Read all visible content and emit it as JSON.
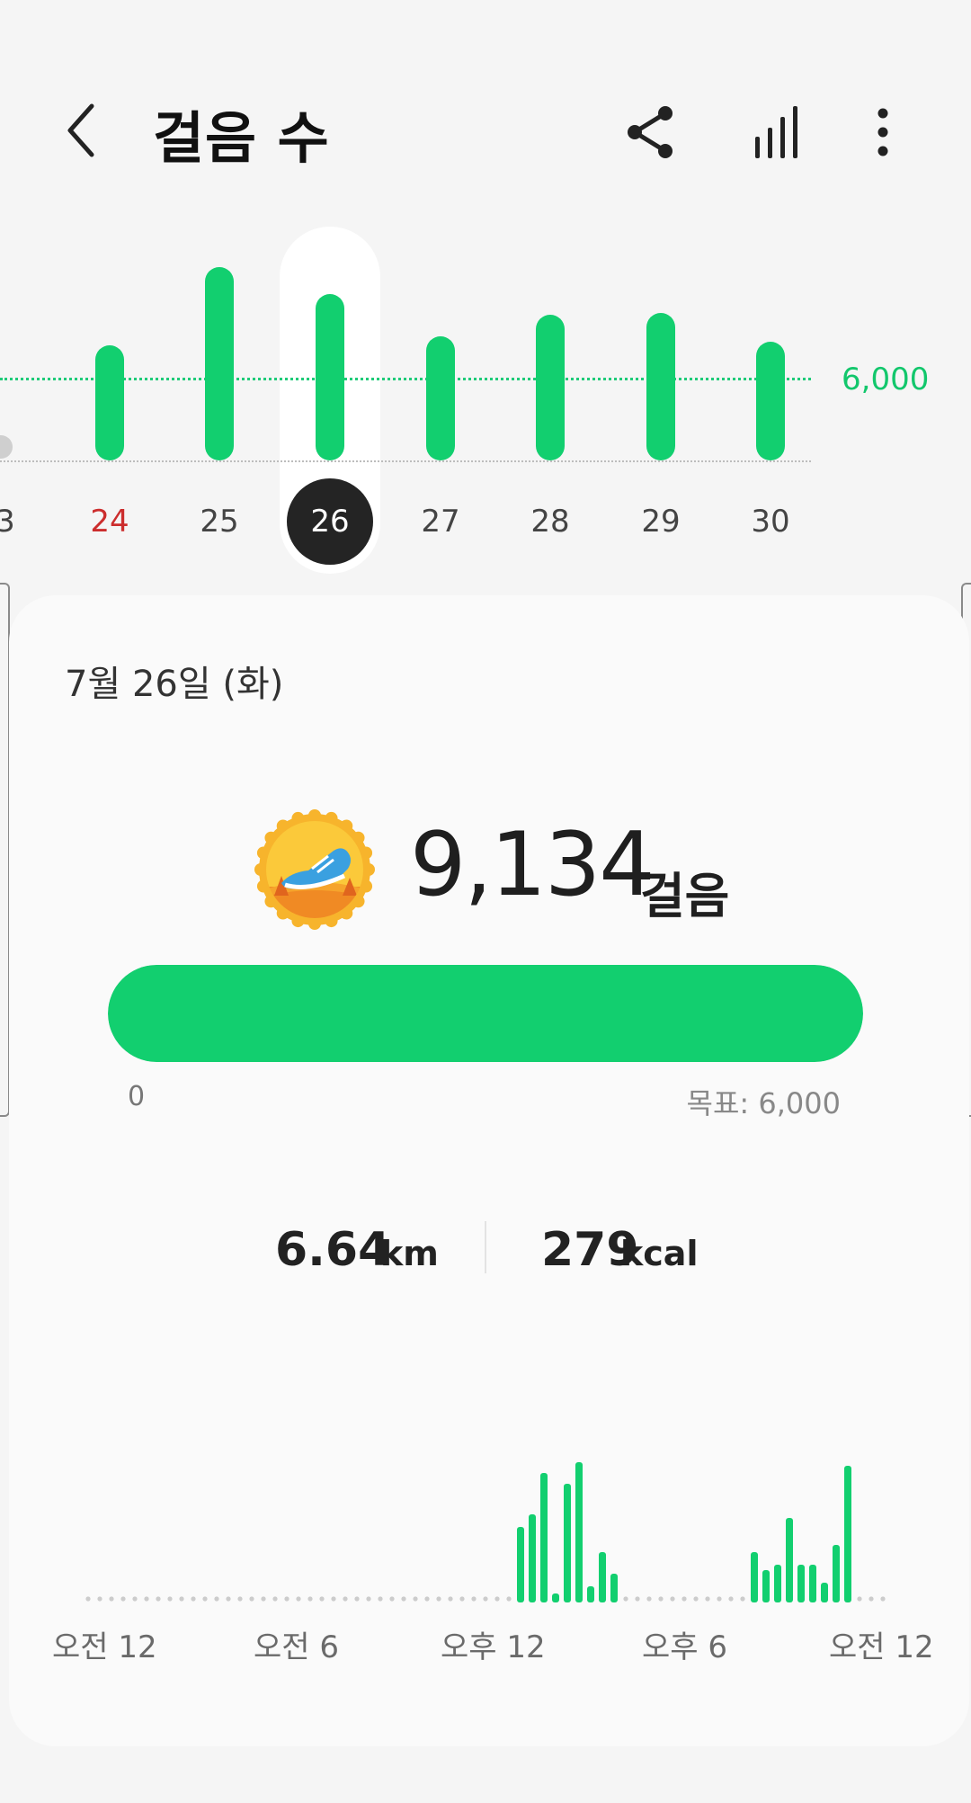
{
  "header": {
    "title": "걸음 수",
    "icons": [
      "back-arrow-icon",
      "share-icon",
      "trend-chart-icon",
      "more-vert-icon"
    ]
  },
  "week": {
    "goal_label": "6,000",
    "accent": "#12cf6f",
    "days": [
      {
        "label": "3",
        "steps": null
      },
      {
        "label": "24",
        "steps": 6300,
        "sunday": true
      },
      {
        "label": "25",
        "steps": 10600
      },
      {
        "label": "26",
        "steps": 9134,
        "selected": true
      },
      {
        "label": "27",
        "steps": 6800
      },
      {
        "label": "28",
        "steps": 8000
      },
      {
        "label": "29",
        "steps": 8100
      },
      {
        "label": "30",
        "steps": 6500
      }
    ]
  },
  "detail": {
    "date": "7월 26일 (화)",
    "steps": "9,134",
    "steps_unit": "걸음",
    "progress_fraction": 1.0,
    "progress_min": "0",
    "progress_goal": "목표: 6,000",
    "distance": "6.64",
    "distance_unit": "km",
    "calories": "279",
    "calories_unit": "kcal",
    "badge_icon": "running-shoe-badge-icon"
  },
  "chart_data": {
    "type": "bar",
    "title": "",
    "x_labels": [
      "오전 12",
      "오전 6",
      "오후 12",
      "오후 6",
      "오전 12"
    ],
    "bars": [
      {
        "slot": 37,
        "value": 0.42
      },
      {
        "slot": 38,
        "value": 0.49
      },
      {
        "slot": 39,
        "value": 0.72
      },
      {
        "slot": 40,
        "value": 0.05
      },
      {
        "slot": 41,
        "value": 0.66
      },
      {
        "slot": 42,
        "value": 0.78
      },
      {
        "slot": 43,
        "value": 0.09
      },
      {
        "slot": 44,
        "value": 0.28
      },
      {
        "slot": 45,
        "value": 0.16
      },
      {
        "slot": 57,
        "value": 0.28
      },
      {
        "slot": 58,
        "value": 0.18
      },
      {
        "slot": 59,
        "value": 0.21
      },
      {
        "slot": 60,
        "value": 0.47
      },
      {
        "slot": 61,
        "value": 0.21
      },
      {
        "slot": 62,
        "value": 0.21
      },
      {
        "slot": 63,
        "value": 0.11
      },
      {
        "slot": 64,
        "value": 0.32
      },
      {
        "slot": 65,
        "value": 0.76
      }
    ],
    "slots": 68,
    "ylim": [
      0,
      1
    ]
  }
}
